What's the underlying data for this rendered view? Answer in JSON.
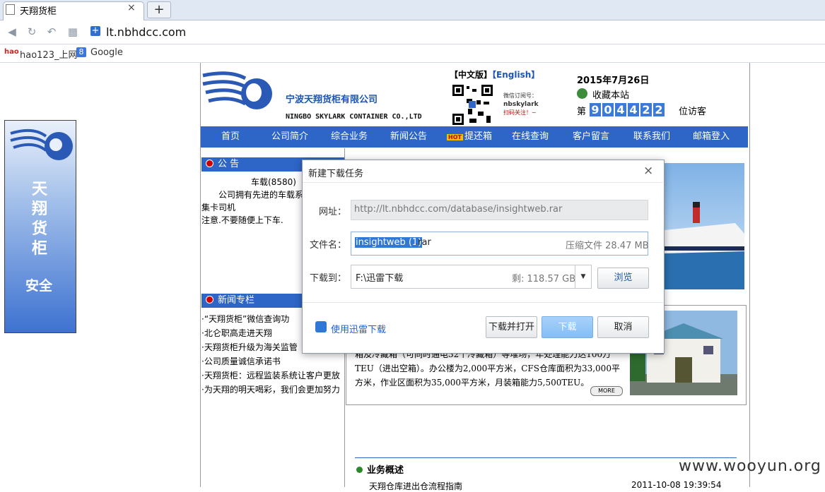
{
  "browser": {
    "tab_title": "天翔货柜",
    "new_tab": "+",
    "close_tab": "×",
    "url": "lt.nbhdcc.com",
    "bookmarks": [
      "hao123_上网",
      "Google"
    ],
    "bookmark_icons": [
      "hao-icon",
      "google-icon"
    ],
    "google_letter": "8"
  },
  "site": {
    "company_cn": "宁波天翔货柜有限公司",
    "company_en": "NINGBO SKYLARK CONTAINER CO.,LTD",
    "lang_cn": "【中文版】",
    "lang_en": "【English】",
    "wechat_line1": "微信订阅号：",
    "wechat_line2": "nbskylark",
    "wechat_line3": "扫码关注！~",
    "date": "2015年7月26日",
    "bookmark_site": "收藏本站",
    "counter_prefix": "第",
    "counter_digits": [
      "9",
      "0",
      "4",
      "4",
      "2",
      "2"
    ],
    "counter_suffix": "位访客",
    "nav": [
      "首页",
      "公司简介",
      "综合业务",
      "新闻公告",
      "提还箱",
      "在线查询",
      "客户留言",
      "联系我们",
      "邮箱登入"
    ],
    "hot_badge": "HOT",
    "notice_title": "公 告",
    "notice_lines": [
      "车载(8580)",
      "公司拥有先进的车载系",
      "集卡司机",
      "注意.不要随便上下车."
    ],
    "news_title": "新闻专栏",
    "news_items": [
      "·“天翔货柜”微信查询功",
      "·北仑职高走进天翔",
      "·天翔货柜升级为海关监管",
      "·公司质量诚信承诺书",
      "·天翔货柜：远程监装系统让客户更放",
      "·为天翔的明天喝彩，我们会更加努力"
    ],
    "intro_text": "箱及冷藏箱（可同时通电32个冷藏箱）等堆场，年处理能力达100万TEU（进出空箱）。办公楼为2,000平方米，CFS仓库面积为33,000平方米，作业区面积为35,000平方米，月装箱能力5,500TEU。",
    "more": "MORE",
    "biz_title": "业务概述",
    "biz_item": "天翔仓库进出仓流程指南",
    "biz_date": "2011-10-08 19:39:54",
    "banner_text": "天翔货柜",
    "banner_safe": "安全"
  },
  "dialog": {
    "title": "新建下载任务",
    "close": "×",
    "url_label": "网址：",
    "url_value": "http://lt.nbhdcc.com/database/insightweb.rar",
    "name_label": "文件名：",
    "name_selected": "insightweb (1)",
    "name_ext": ".rar",
    "name_size": "压缩文件 28.47 MB",
    "path_label": "下载到：",
    "path_value": "F:\\迅雷下载",
    "path_free": "剩: 118.57 GB",
    "browse": "浏览",
    "xunlei_link": "使用迅雷下载",
    "btn_download_open": "下载并打开",
    "btn_download": "下载",
    "btn_cancel": "取消"
  },
  "watermark": "www.wooyun.org",
  "colors": {
    "accent": "#2e66c7",
    "dialog_primary": "#84bdf5",
    "link": "#1c5fd6"
  }
}
